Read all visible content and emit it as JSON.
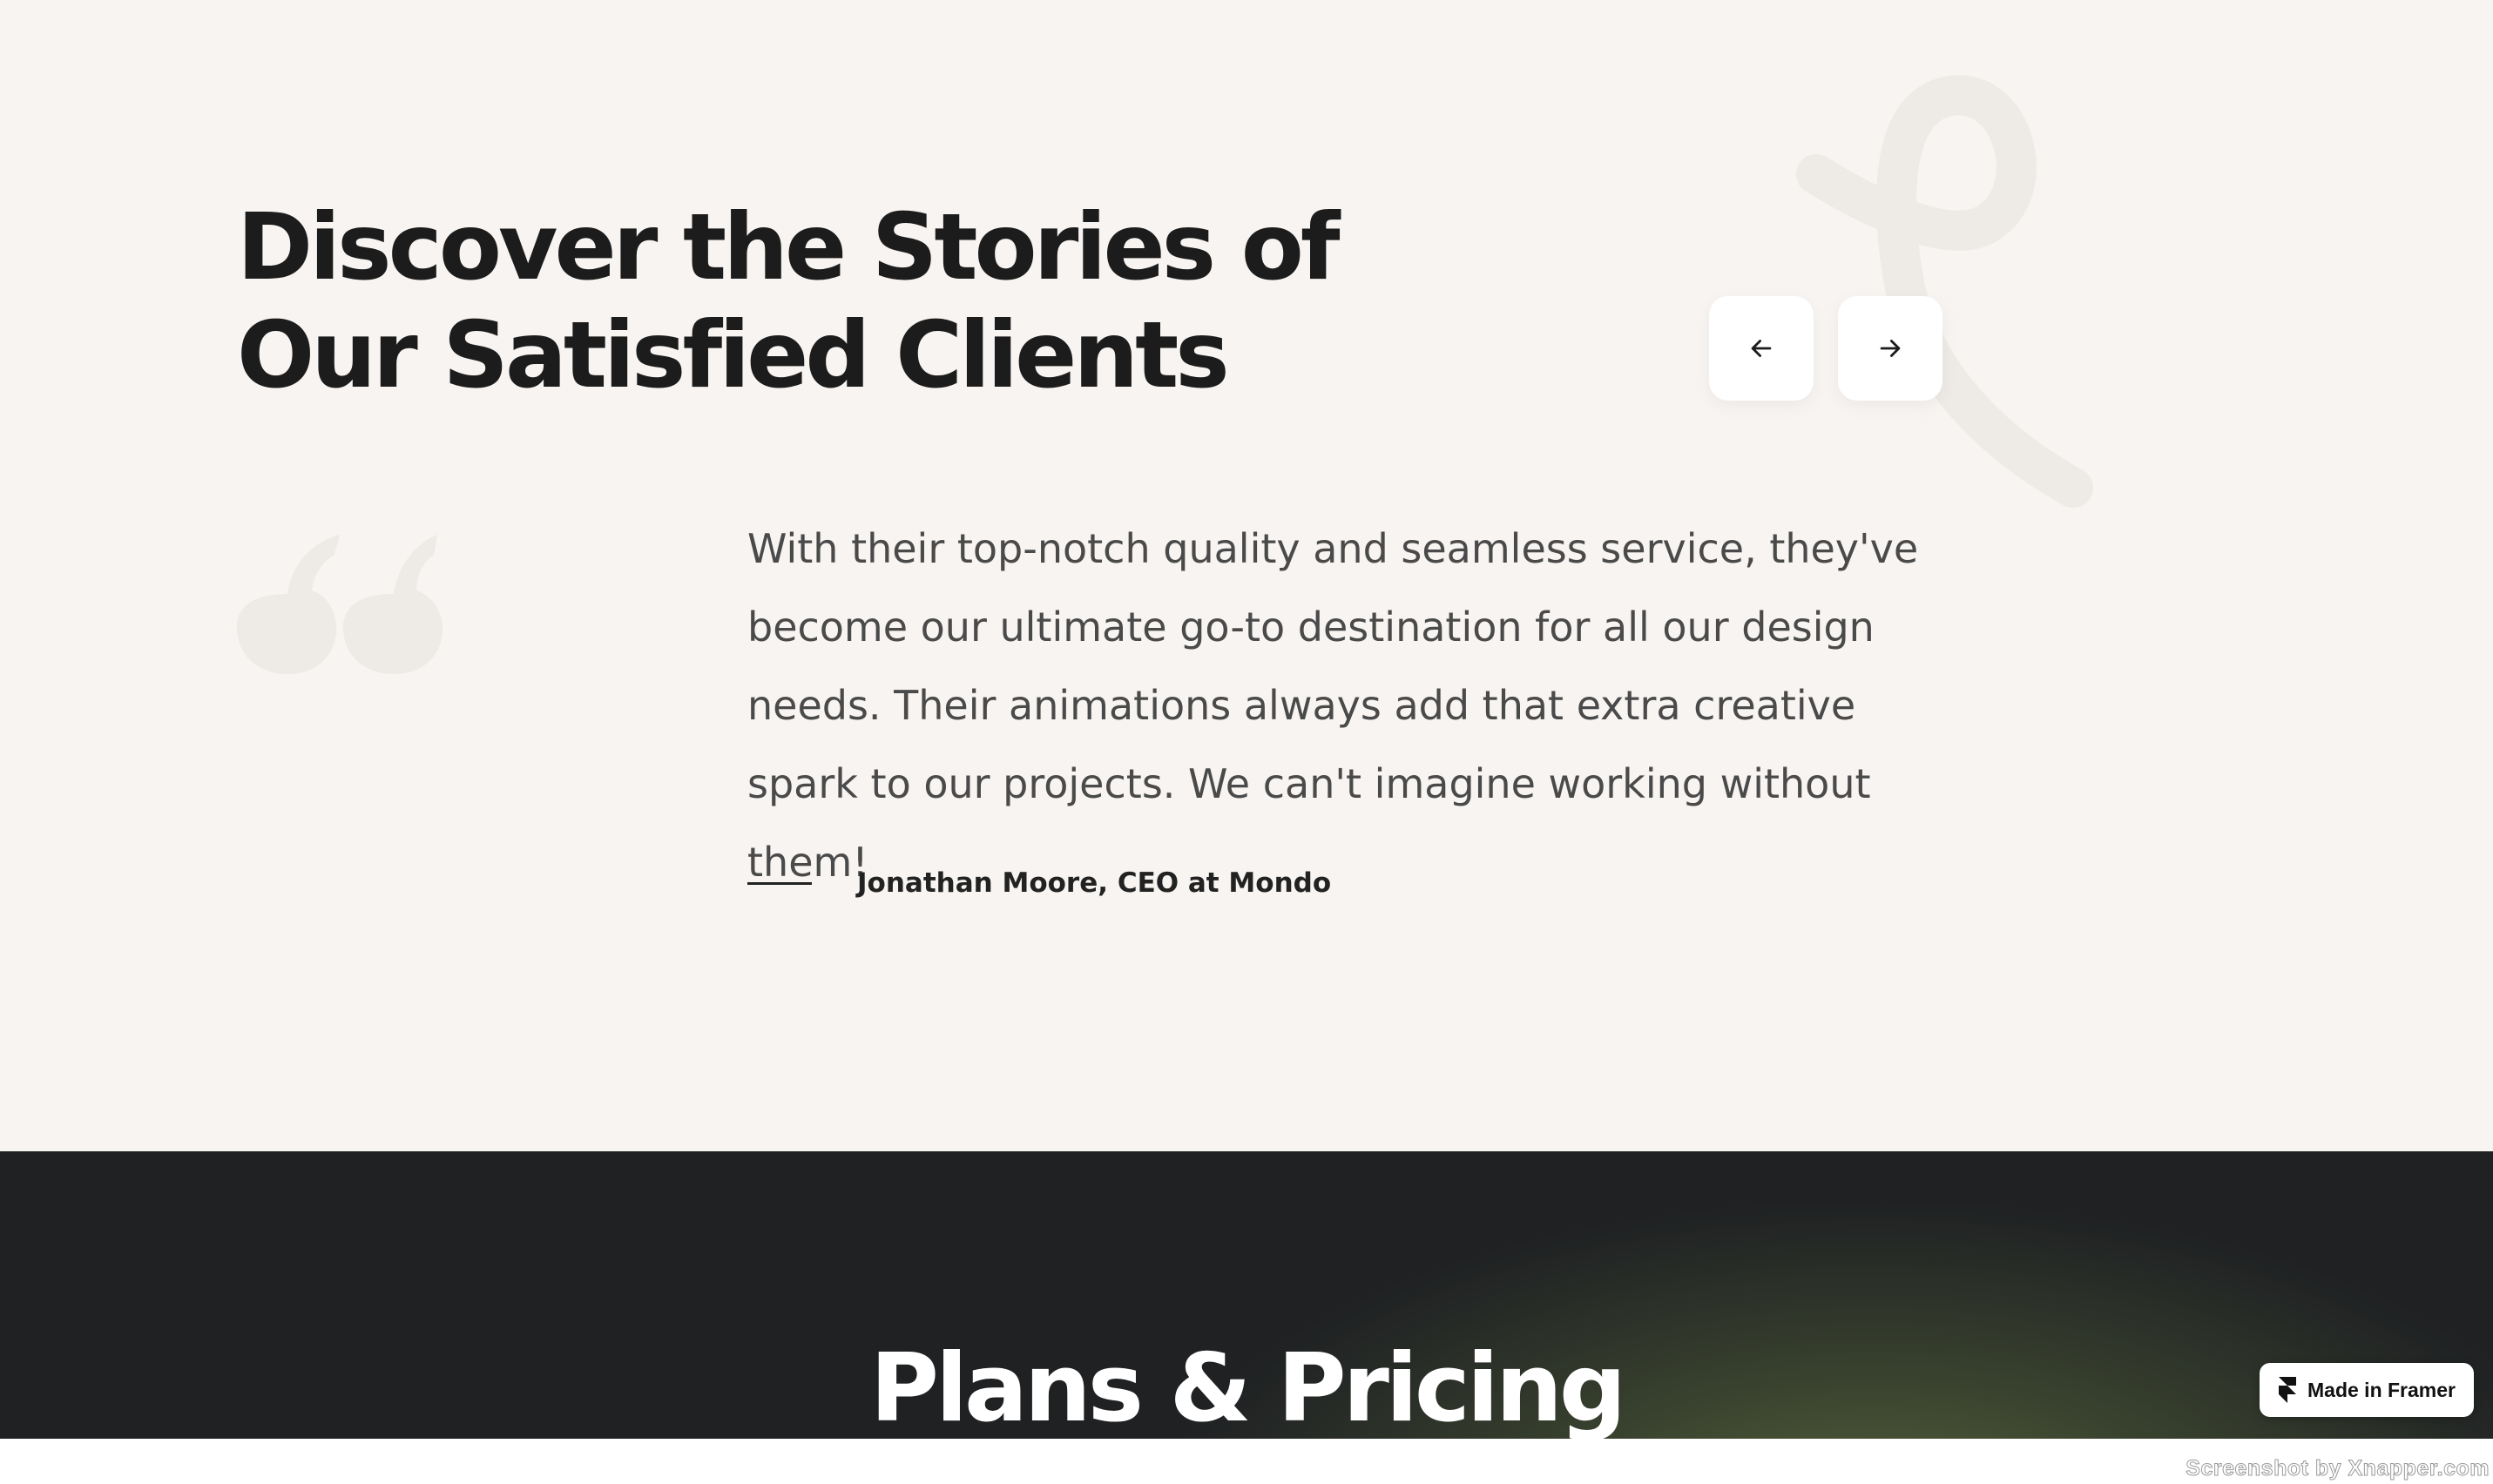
{
  "testimonials": {
    "heading_line1": "Discover the Stories of",
    "heading_line2": "Our Satisfied Clients",
    "nav": {
      "prev_icon": "arrow-left-icon",
      "next_icon": "arrow-right-icon"
    },
    "quote": "With their top-notch quality and seamless service, they've become our ultimate go-to destination for all our design needs. Their animations always add that extra creative spark to our projects. We can't imagine working without them!",
    "author": "Jonathan Moore, CEO at Mondo"
  },
  "pricing": {
    "title": "Plans & Pricing"
  },
  "framer_badge": {
    "label": "Made in Framer",
    "icon": "framer-logo-icon"
  },
  "watermark": "Screenshot by Xnapper.com",
  "colors": {
    "section_bg": "#f7f4f1",
    "heading": "#1c1c1c",
    "body_text": "#4a4a4a",
    "decor": "#eeeae6",
    "pricing_bg": "#1f2123",
    "pricing_glow": "#5d6c40"
  }
}
